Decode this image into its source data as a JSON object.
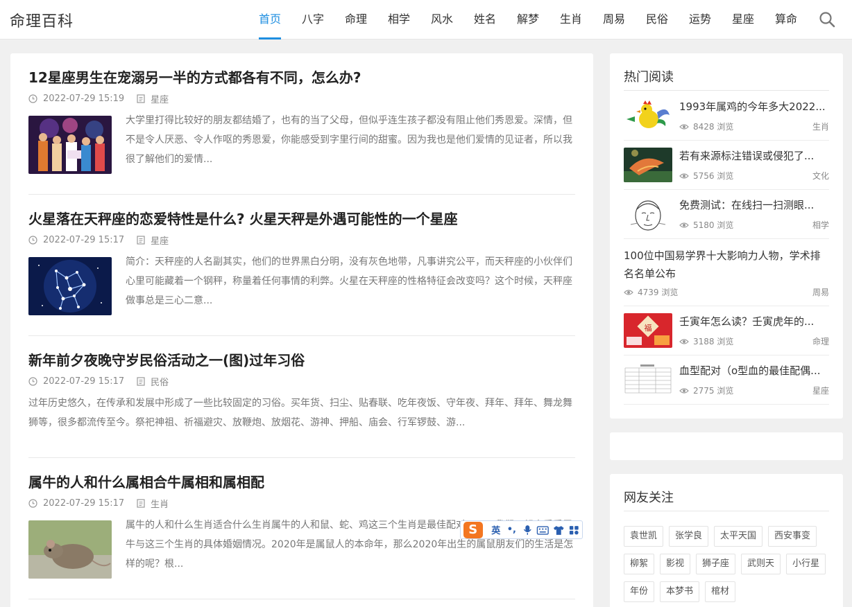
{
  "header": {
    "logo": "命理百科",
    "nav": [
      "首页",
      "八字",
      "命理",
      "相学",
      "风水",
      "姓名",
      "解梦",
      "生肖",
      "周易",
      "民俗",
      "运势",
      "星座",
      "算命"
    ],
    "active_index": 0
  },
  "articles": [
    {
      "title": "12星座男生在宠溺另一半的方式都各有不同，怎么办?",
      "date": "2022-07-29 15:19",
      "category": "星座",
      "excerpt": "大学里打得比较好的朋友都结婚了，也有的当了父母，但似乎连生孩子都没有阻止他们秀恩爱。深情，但不是令人厌恶、令人作呕的秀恩爱，你能感受到字里行间的甜蜜。因为我也是他们爱情的见证者，所以我很了解他们的爱情...",
      "thumb": "party-photo"
    },
    {
      "title": "火星落在天秤座的恋爱特性是什么? 火星天秤是外遇可能性的一个星座",
      "date": "2022-07-29 15:17",
      "category": "星座",
      "excerpt": "简介：天秤座的人名副其实，他们的世界黑白分明，没有灰色地带，凡事讲究公平，而天秤座的小伙伴们心里可能藏着一个钢秤，称量着任何事情的利弊。火星在天秤座的性格特征会改变吗？这个时候，天秤座做事总是三心二意...",
      "thumb": "libra-constellation"
    },
    {
      "title": "新年前夕夜晚守岁民俗活动之一(图)过年习俗",
      "date": "2022-07-29 15:17",
      "category": "民俗",
      "excerpt": "过年历史悠久，在传承和发展中形成了一些比较固定的习俗。买年货、扫尘、贴春联、吃年夜饭、守年夜、拜年、拜年、舞龙舞狮等，很多都流传至今。祭祀神祖、祈福避灾、放鞭炮、放烟花、游神、押船、庙会、行军锣鼓、游..."
    },
    {
      "title": "属牛的人和什么属相合牛属相和属相配",
      "date": "2022-07-29 15:17",
      "category": "生肖",
      "excerpt": "属牛的人和什么生肖适合什么生肖属牛的人和鼠、蛇、鸡这三个生肖是最佳配对，下面我们一起来看看属牛与这三个生肖的具体婚姻情况。2020年是属鼠人的本命年，那么2020年出生的属鼠朋友们的生活是怎样的呢？根...",
      "thumb": "mouse-photo"
    }
  ],
  "sidebar": {
    "hot_title": "热门阅读",
    "hot": [
      {
        "title": "1993年属鸡的今年多大2022...",
        "views": "8428 浏览",
        "category": "生肖",
        "thumb": "rooster-cartoon"
      },
      {
        "title": "若有来源标注错误或侵犯了...",
        "views": "5756 浏览",
        "category": "文化",
        "thumb": "fish-sculpture"
      },
      {
        "title": "免费测试：在线扫一扫测眼...",
        "views": "5180 浏览",
        "category": "相学",
        "thumb": "face-sketch"
      },
      {
        "title": "100位中国易学界十大影响力人物，学术排名名单公布",
        "views": "4739 浏览",
        "category": "周易"
      },
      {
        "title": "壬寅年怎么读？壬寅虎年的...",
        "views": "3188 浏览",
        "category": "命理",
        "thumb": "new-year-red"
      },
      {
        "title": "血型配对（o型血的最佳配偶...",
        "views": "2775 浏览",
        "category": "星座",
        "thumb": "blood-type-table"
      }
    ],
    "follow_title": "网友关注",
    "tags": [
      "袁世凯",
      "张学良",
      "太平天国",
      "西安事变",
      "柳絮",
      "影视",
      "狮子座",
      "武则天",
      "小行星",
      "年份",
      "本梦书",
      "棺材"
    ]
  },
  "ime": {
    "logo": "S",
    "mode": "英",
    "punct": "•,",
    "icons": [
      "microphone-icon",
      "keyboard-icon",
      "shirt-icon",
      "grid-icon"
    ]
  },
  "colors": {
    "accent": "#1e8ee0",
    "ime_orange": "#f37621"
  }
}
